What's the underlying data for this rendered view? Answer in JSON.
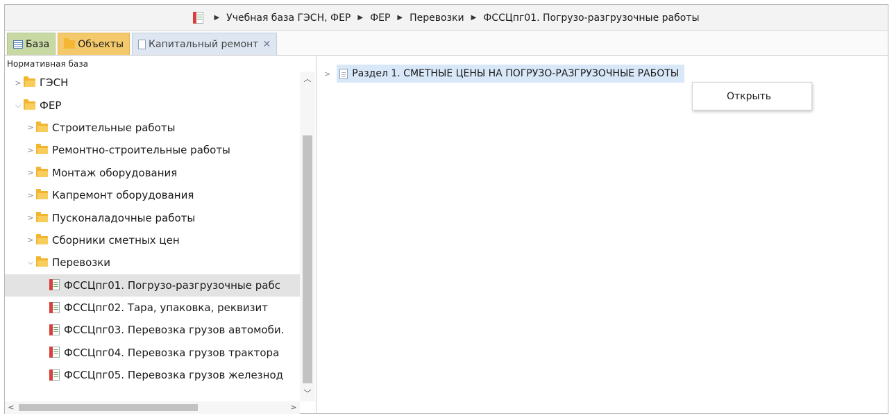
{
  "breadcrumb": {
    "items": [
      "Учебная база ГЭСН, ФЕР",
      "ФЕР",
      "Перевозки",
      "ФССЦпг01. Погрузо-разгрузочные работы"
    ]
  },
  "tabs": [
    {
      "label": "База",
      "icon": "grid-icon"
    },
    {
      "label": "Объекты",
      "icon": "folder-icon"
    },
    {
      "label": "Капитальный ремонт",
      "icon": "page-icon"
    }
  ],
  "left_panel": {
    "header": "Нормативная база",
    "tree": [
      {
        "label": "ГЭСН",
        "level": 1,
        "expanded": false,
        "icon": "folder"
      },
      {
        "label": "ФЕР",
        "level": 1,
        "expanded": true,
        "icon": "folder"
      },
      {
        "label": "Строительные работы",
        "level": 2,
        "expanded": false,
        "icon": "folder"
      },
      {
        "label": "Ремонтно-строительные работы",
        "level": 2,
        "expanded": false,
        "icon": "folder"
      },
      {
        "label": "Монтаж оборудования",
        "level": 2,
        "expanded": false,
        "icon": "folder"
      },
      {
        "label": "Капремонт оборудования",
        "level": 2,
        "expanded": false,
        "icon": "folder"
      },
      {
        "label": "Пусконаладочные работы",
        "level": 2,
        "expanded": false,
        "icon": "folder"
      },
      {
        "label": "Сборники сметных цен",
        "level": 2,
        "expanded": false,
        "icon": "folder"
      },
      {
        "label": "Перевозки",
        "level": 2,
        "expanded": true,
        "icon": "folder"
      },
      {
        "label": "ФССЦпг01. Погрузо-разгрузочные рабс",
        "level": 3,
        "selected": true,
        "icon": "doc"
      },
      {
        "label": "ФССЦпг02. Тара, упаковка, реквизит",
        "level": 3,
        "icon": "doc"
      },
      {
        "label": "ФССЦпг03. Перевозка грузов автомоби.",
        "level": 3,
        "icon": "doc"
      },
      {
        "label": "ФССЦпг04. Перевозка грузов трактора",
        "level": 3,
        "icon": "doc"
      },
      {
        "label": "ФССЦпг05. Перевозка грузов железнод",
        "level": 3,
        "icon": "doc"
      }
    ]
  },
  "right_panel": {
    "section_label": "Раздел 1. СМЕТНЫЕ ЦЕНЫ НА ПОГРУЗО-РАЗГРУЗОЧНЫЕ РАБОТЫ"
  },
  "context_menu": {
    "items": [
      "Открыть"
    ]
  }
}
